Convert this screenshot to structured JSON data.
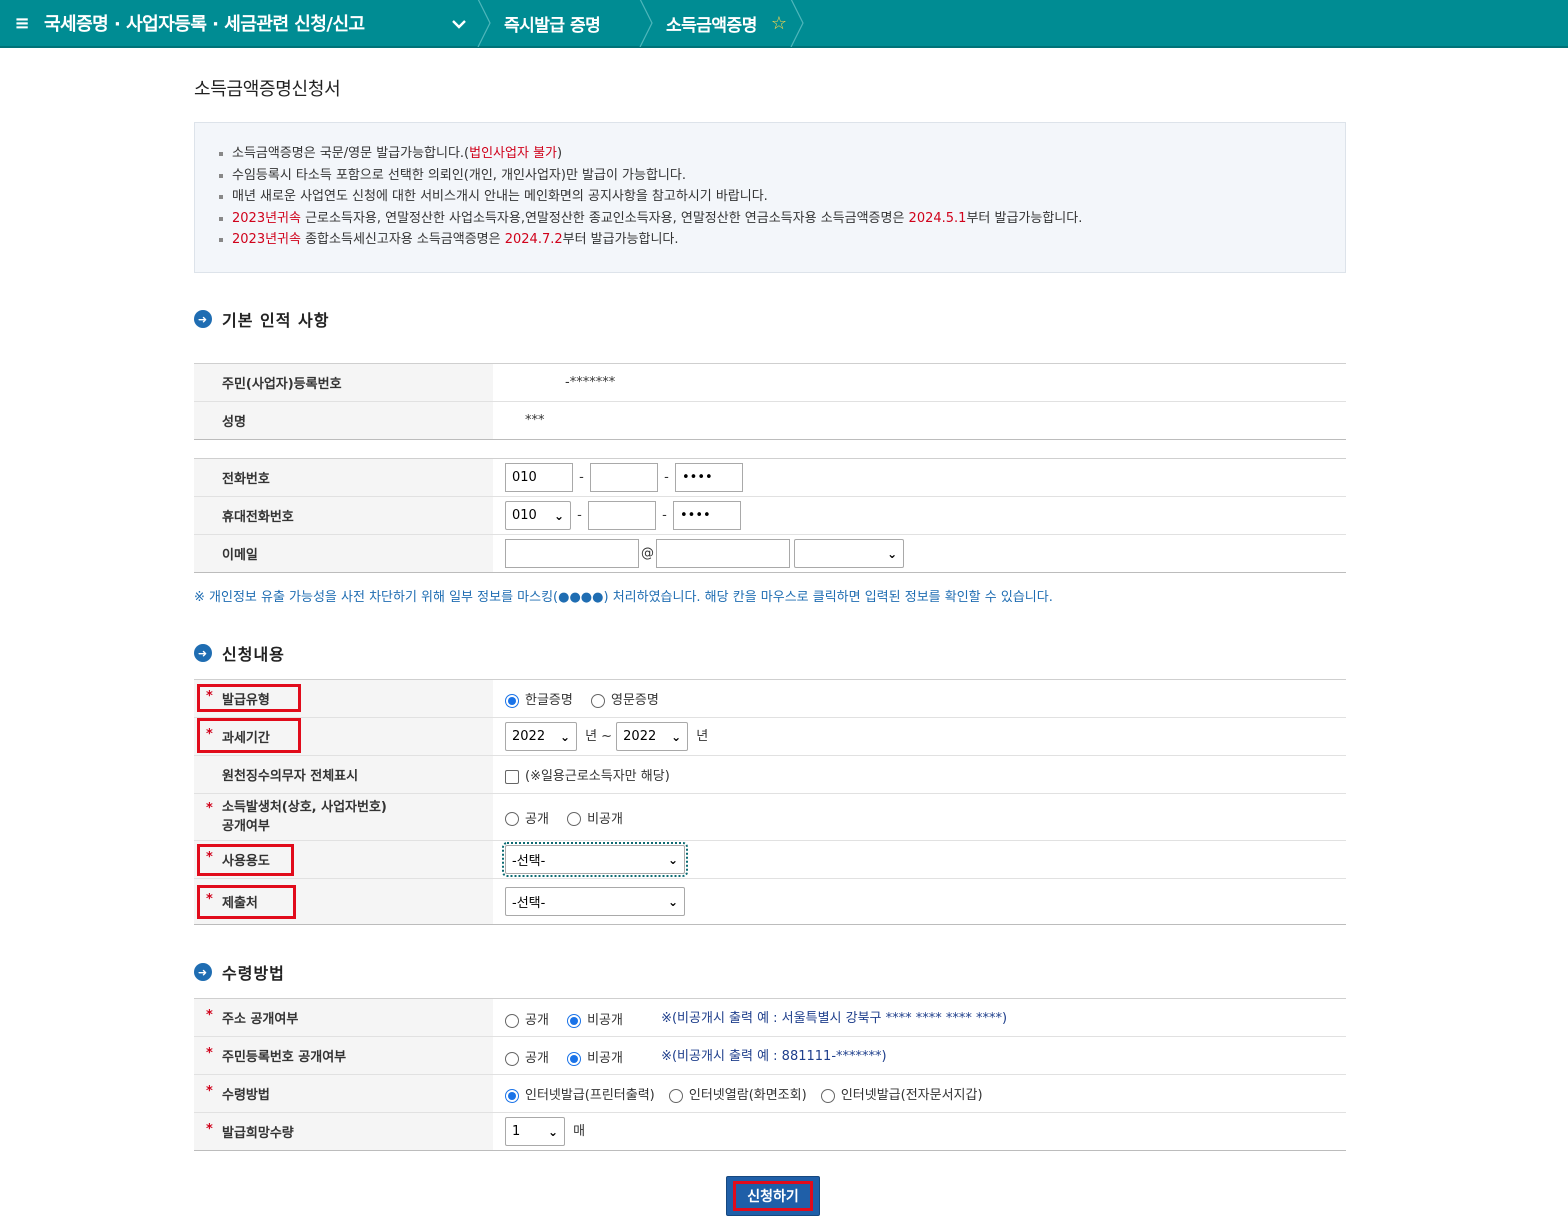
{
  "topbar": {
    "menu_icon": "≡",
    "main": "국세증명 · 사업자등록 · 세금관련 신청/신고",
    "item1": "즉시발급 증명",
    "item2": "소득금액증명"
  },
  "page_title": "소득금액증명신청서",
  "notice": {
    "l1a": "소득금액증명은 국문/영문 발급가능합니다.(",
    "l1b": "법인사업자 불가",
    "l1c": ")",
    "l2": "수임등록시 타소득 포함으로 선택한 의뢰인(개인, 개인사업자)만 발급이 가능합니다.",
    "l3": "매년 새로운 사업연도 신청에 대한 서비스개시 안내는 메인화면의 공지사항을 참고하시기 바랍니다.",
    "l4a": "2023년귀속",
    "l4b": " 근로소득자용, 연말정산한 사업소득자용,연말정산한 종교인소득자용, 연말정산한 연금소득자용 소득금액증명은 ",
    "l4c": "2024.5.1",
    "l4d": "부터 발급가능합니다.",
    "l5a": "2023년귀속",
    "l5b": " 종합소득세신고자용 소득금액증명은 ",
    "l5c": "2024.7.2",
    "l5d": "부터 발급가능합니다."
  },
  "basic": {
    "title": "기본 인적 사항",
    "ssn_label": "주민(사업자)등록번호",
    "ssn_value": "-*******",
    "name_label": "성명",
    "name_value": "***",
    "phone_label": "전화번호",
    "phone1": "010",
    "phone3": "••••",
    "mobile_label": "휴대전화번호",
    "mobile1": "010",
    "mobile3": "••••",
    "email_label": "이메일",
    "at": "@",
    "privacy_note": "※ 개인정보 유출 가능성을 사전 차단하기 위해 일부 정보를 마스킹(●●●●) 처리하였습니다. 해당 칸을 마우스로 클릭하면 입력된 정보를 확인할 수 있습니다."
  },
  "apply": {
    "title": "신청내용",
    "type_label": "발급유형",
    "type_opt1": "한글증명",
    "type_opt2": "영문증명",
    "period_label": "과세기간",
    "period_from": "2022",
    "period_to": "2022",
    "year": "년",
    "tilde": "~",
    "withhold_label": "원천징수의무자 전체표시",
    "withhold_note": "(※일용근로소득자만 해당)",
    "source_label1": "소득발생처(상호, 사업자번호)",
    "source_label2": "공개여부",
    "public": "공개",
    "private": "비공개",
    "usage_label": "사용용도",
    "usage_value": "-선택-",
    "submit_to_label": "제출처",
    "submit_to_value": "-선택-"
  },
  "receive": {
    "title": "수령방법",
    "addr_label": "주소 공개여부",
    "addr_hint": "※(비공개시 출력 예 : 서울특별시 강북구 **** **** **** ****)",
    "rrn_label": "주민등록번호 공개여부",
    "rrn_hint": "※(비공개시 출력 예 : 881111-*******)",
    "method_label": "수령방법",
    "method1": "인터넷발급(프린터출력)",
    "method2": "인터넷열람(화면조회)",
    "method3": "인터넷발급(전자문서지갑)",
    "count_label": "발급희망수량",
    "count_value": "1",
    "count_unit": "매",
    "public": "공개",
    "private": "비공개"
  },
  "req_mark": "*",
  "submit_label": "신청하기"
}
